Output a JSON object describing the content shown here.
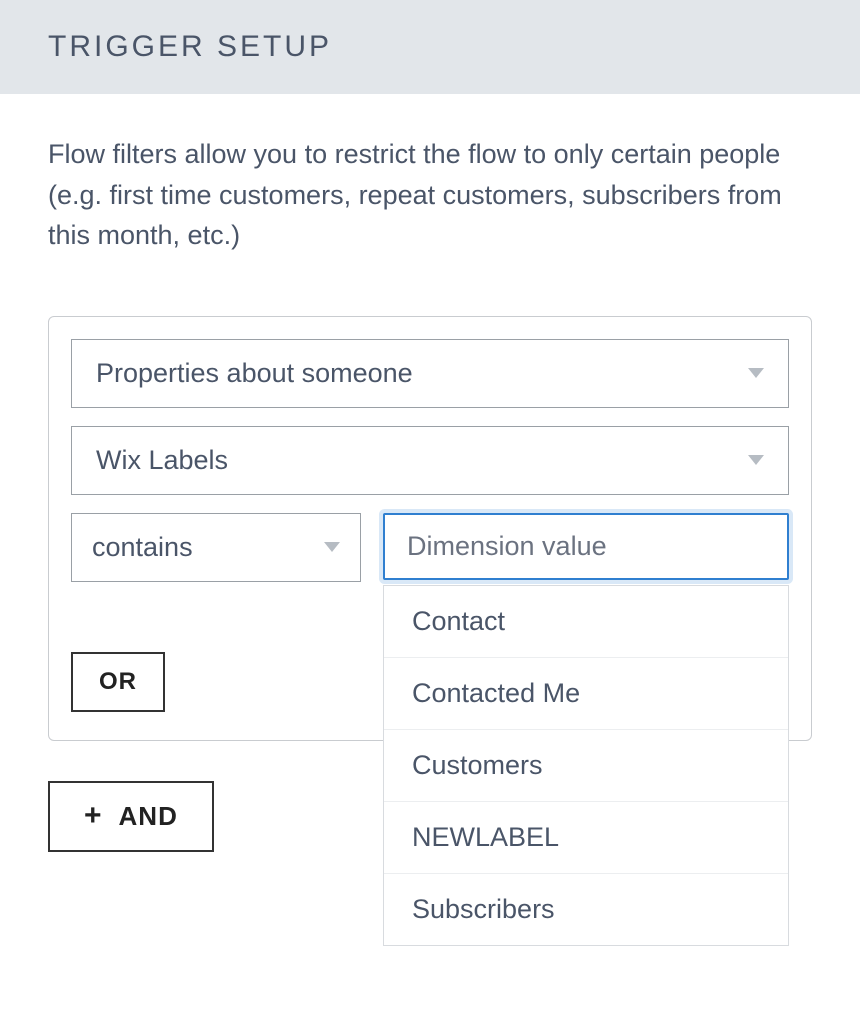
{
  "header": {
    "title": "TRIGGER SETUP"
  },
  "description": "Flow filters allow you to restrict the flow to only certain people (e.g. first time customers, repeat customers, subscribers from this month, etc.)",
  "filter": {
    "condition_type": "Properties about someone",
    "property": "Wix Labels",
    "operator": "contains",
    "value_placeholder": "Dimension value",
    "value_options": [
      "Contact",
      "Contacted Me",
      "Customers",
      "NEWLABEL",
      "Subscribers"
    ]
  },
  "buttons": {
    "or": "OR",
    "and": "AND",
    "plus": "+"
  }
}
